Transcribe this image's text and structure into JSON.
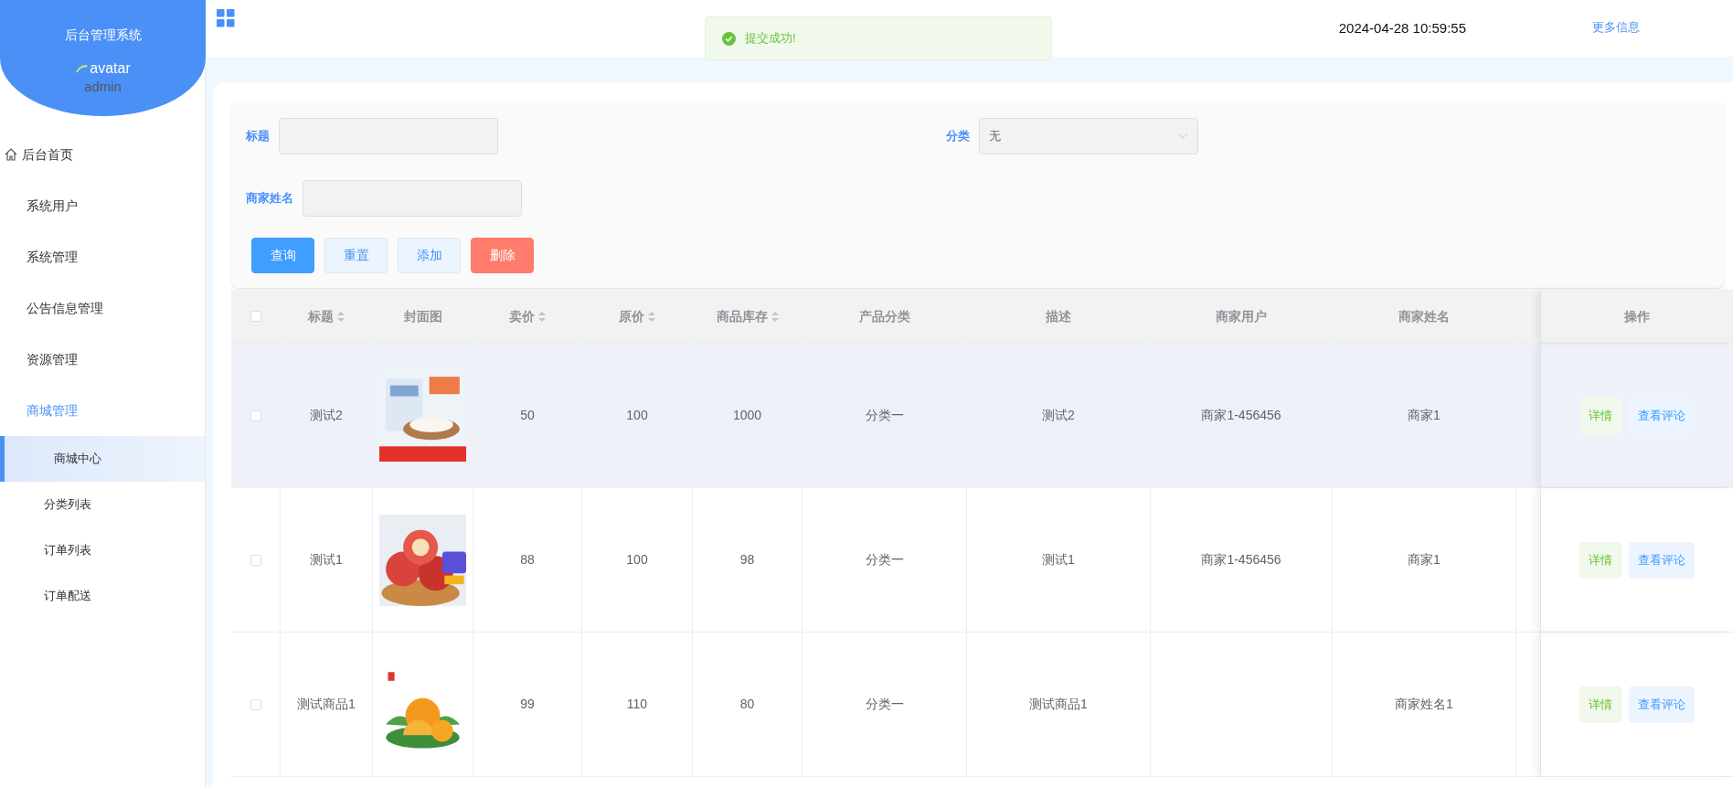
{
  "sidebar": {
    "title": "后台管理系统",
    "avatar_alt": "avatar",
    "username": "admin",
    "items": [
      {
        "label": "后台首页",
        "kind": "home",
        "expanded": false
      },
      {
        "label": "系统用户",
        "kind": "plain",
        "expanded": false
      },
      {
        "label": "系统管理",
        "kind": "plain",
        "expanded": false
      },
      {
        "label": "公告信息管理",
        "kind": "plain",
        "expanded": false
      },
      {
        "label": "资源管理",
        "kind": "plain",
        "expanded": false
      },
      {
        "label": "商城管理",
        "kind": "plain",
        "expanded": true,
        "children": [
          {
            "label": "商城中心",
            "selected": true
          },
          {
            "label": "分类列表",
            "selected": false
          },
          {
            "label": "订单列表",
            "selected": false
          },
          {
            "label": "订单配送",
            "selected": false
          }
        ]
      }
    ]
  },
  "header": {
    "datetime": "2024-04-28 10:59:55",
    "link": "更多信息"
  },
  "toast": {
    "kind": "success",
    "message": "提交成功!"
  },
  "filters": {
    "fields": [
      {
        "label": "标题",
        "kind": "input"
      },
      {
        "label": "分类",
        "kind": "select",
        "value": "无"
      },
      {
        "label": "商家姓名",
        "kind": "input"
      }
    ],
    "buttons": [
      {
        "label": "查询",
        "kind": "primary"
      },
      {
        "label": "重置",
        "kind": "plain"
      },
      {
        "label": "添加",
        "kind": "plain"
      },
      {
        "label": "删除",
        "kind": "danger"
      }
    ]
  },
  "table": {
    "all_selected": false,
    "columns": [
      {
        "label": "标题",
        "sortable": true
      },
      {
        "label": "封面图",
        "sortable": false
      },
      {
        "label": "卖价",
        "sortable": true
      },
      {
        "label": "原价",
        "sortable": true
      },
      {
        "label": "商品库存",
        "sortable": true
      },
      {
        "label": "产品分类",
        "sortable": false
      },
      {
        "label": "描述",
        "sortable": false
      },
      {
        "label": "商家用户",
        "sortable": false
      },
      {
        "label": "商家姓名",
        "sortable": false
      },
      {
        "label": "操作",
        "sortable": false
      }
    ],
    "rows": [
      {
        "selected": false,
        "highlighted": true,
        "title": "测试2",
        "cover": {
          "kind": "picture"
        },
        "price": "50",
        "original_price": "100",
        "stock": "1000",
        "category": "分类一",
        "description": "测试2",
        "merchant_user": "商家1-456456",
        "merchant_name": "商家1",
        "actions": [
          "详情",
          "查看评论"
        ]
      },
      {
        "selected": false,
        "highlighted": false,
        "title": "测试1",
        "cover": {
          "kind": "picture"
        },
        "price": "88",
        "original_price": "100",
        "stock": "98",
        "category": "分类一",
        "description": "测试1",
        "merchant_user": "商家1-456456",
        "merchant_name": "商家1",
        "actions": [
          "详情",
          "查看评论"
        ]
      },
      {
        "selected": false,
        "highlighted": false,
        "title": "测试商品1",
        "cover": {
          "kind": "picture"
        },
        "price": "99",
        "original_price": "110",
        "stock": "80",
        "category": "分类一",
        "description": "测试商品1",
        "merchant_user": "",
        "merchant_name": "商家姓名1",
        "actions": [
          "详情",
          "查看评论"
        ]
      }
    ]
  }
}
